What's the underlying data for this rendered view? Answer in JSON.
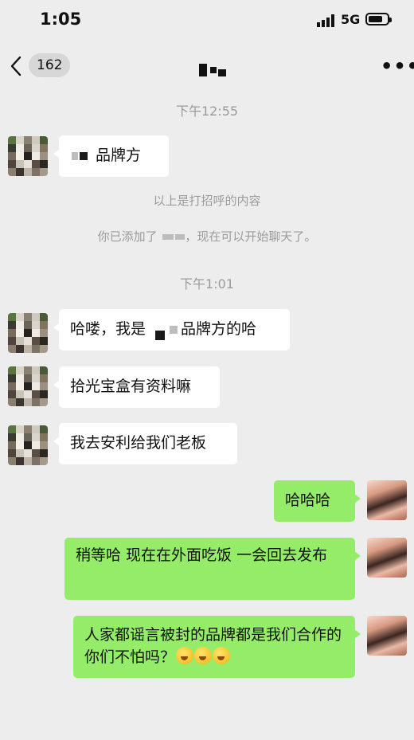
{
  "status_bar": {
    "time": "1:05",
    "network": "5G"
  },
  "nav": {
    "back_count": "162",
    "more": "•••"
  },
  "timestamps": [
    "下午12:55",
    "下午1:01"
  ],
  "system_messages": {
    "greeting_note": "以上是打招呼的内容",
    "added_prefix": "你已添加了",
    "added_suffix": "，现在可以开始聊天了。"
  },
  "messages": [
    {
      "side": "left",
      "prefix": "",
      "suffix": "品牌方"
    },
    {
      "side": "left",
      "prefix": "哈喽，我是",
      "suffix": "品牌方的哈"
    },
    {
      "side": "left",
      "text": "拾光宝盒有资料嘛"
    },
    {
      "side": "left",
      "text": "我去安利给我们老板"
    },
    {
      "side": "right",
      "text": "哈哈哈"
    },
    {
      "side": "right",
      "text": "稍等哈 现在在外面吃饭 一会回去发布"
    },
    {
      "side": "right",
      "text": "人家都谣言被封的品牌都是我们合作的你们不怕吗？"
    }
  ],
  "colors": {
    "background": "#ededed",
    "sent_bubble": "#95ec69",
    "received_bubble": "#ffffff",
    "system_text": "#9b9b9b"
  }
}
